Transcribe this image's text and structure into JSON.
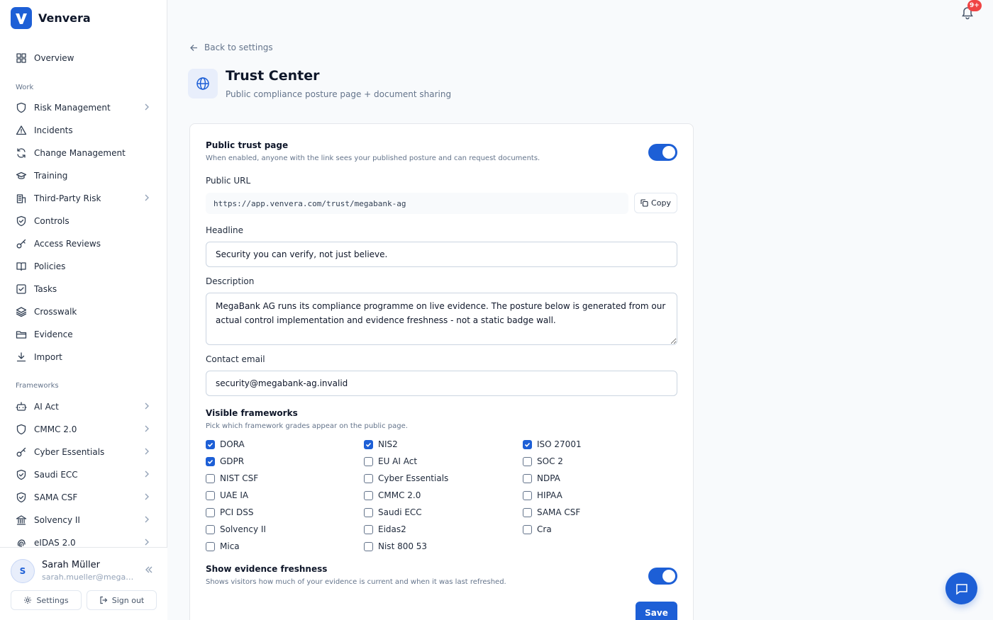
{
  "app": {
    "name": "Venvera"
  },
  "sidebar": {
    "overview": {
      "label": "Overview",
      "icon": "grid-icon"
    },
    "work_label": "Work",
    "work_items": [
      {
        "label": "Risk Management",
        "icon": "shield-icon",
        "has_chevron": true
      },
      {
        "label": "Incidents",
        "icon": "alert-triangle-icon",
        "has_chevron": false
      },
      {
        "label": "Change Management",
        "icon": "refresh-icon",
        "has_chevron": false
      },
      {
        "label": "Training",
        "icon": "graduation-cap-icon",
        "has_chevron": false
      },
      {
        "label": "Third-Party Risk",
        "icon": "building-icon",
        "has_chevron": true
      },
      {
        "label": "Controls",
        "icon": "shield-check-icon",
        "has_chevron": false
      },
      {
        "label": "Access Reviews",
        "icon": "key-icon",
        "has_chevron": false
      },
      {
        "label": "Policies",
        "icon": "book-icon",
        "has_chevron": false
      },
      {
        "label": "Tasks",
        "icon": "checkbox-icon",
        "has_chevron": false
      },
      {
        "label": "Crosswalk",
        "icon": "layers-icon",
        "has_chevron": false
      },
      {
        "label": "Evidence",
        "icon": "folder-icon",
        "has_chevron": false
      },
      {
        "label": "Import",
        "icon": "download-icon",
        "has_chevron": false
      }
    ],
    "frameworks_label": "Frameworks",
    "framework_items": [
      {
        "label": "AI Act",
        "icon": "bot-icon",
        "has_chevron": true
      },
      {
        "label": "CMMC 2.0",
        "icon": "shield-icon",
        "has_chevron": true
      },
      {
        "label": "Cyber Essentials",
        "icon": "key-icon",
        "has_chevron": true
      },
      {
        "label": "Saudi ECC",
        "icon": "shield-check-icon",
        "has_chevron": true
      },
      {
        "label": "SAMA CSF",
        "icon": "shield-check-icon",
        "has_chevron": true
      },
      {
        "label": "Solvency II",
        "icon": "landmark-icon",
        "has_chevron": true
      },
      {
        "label": "eIDAS 2.0",
        "icon": "fingerprint-icon",
        "has_chevron": true
      }
    ],
    "user": {
      "initial": "S",
      "name": "Sarah Müller",
      "email": "sarah.mueller@megaba..."
    },
    "settings_label": "Settings",
    "signout_label": "Sign out"
  },
  "header": {
    "notification_badge": "9+"
  },
  "page": {
    "back_label": "Back to settings",
    "title": "Trust Center",
    "subtitle": "Public compliance posture page + document sharing"
  },
  "form": {
    "public_page": {
      "title": "Public trust page",
      "hint": "When enabled, anyone with the link sees your published posture and can request documents.",
      "enabled": true
    },
    "public_url": {
      "label": "Public URL",
      "value": "https://app.venvera.com/trust/megabank-ag",
      "copy_label": "Copy"
    },
    "headline": {
      "label": "Headline",
      "value": "Security you can verify, not just believe."
    },
    "description": {
      "label": "Description",
      "value": "MegaBank AG runs its compliance programme on live evidence. The posture below is generated from our actual control implementation and evidence freshness - not a static badge wall."
    },
    "contact_email": {
      "label": "Contact email",
      "value": "security@megabank-ag.invalid"
    },
    "frameworks": {
      "title": "Visible frameworks",
      "hint": "Pick which framework grades appear on the public page.",
      "items": [
        {
          "label": "DORA",
          "checked": true
        },
        {
          "label": "NIS2",
          "checked": true
        },
        {
          "label": "ISO 27001",
          "checked": true
        },
        {
          "label": "GDPR",
          "checked": true
        },
        {
          "label": "EU AI Act",
          "checked": false
        },
        {
          "label": "SOC 2",
          "checked": false
        },
        {
          "label": "NIST CSF",
          "checked": false
        },
        {
          "label": "Cyber Essentials",
          "checked": false
        },
        {
          "label": "NDPA",
          "checked": false
        },
        {
          "label": "UAE IA",
          "checked": false
        },
        {
          "label": "CMMC 2.0",
          "checked": false
        },
        {
          "label": "HIPAA",
          "checked": false
        },
        {
          "label": "PCI DSS",
          "checked": false
        },
        {
          "label": "Saudi ECC",
          "checked": false
        },
        {
          "label": "SAMA CSF",
          "checked": false
        },
        {
          "label": "Solvency II",
          "checked": false
        },
        {
          "label": "Eidas2",
          "checked": false
        },
        {
          "label": "Cra",
          "checked": false
        },
        {
          "label": "Mica",
          "checked": false
        },
        {
          "label": "Nist 800 53",
          "checked": false
        }
      ]
    },
    "freshness": {
      "title": "Show evidence freshness",
      "hint": "Shows visitors how much of your evidence is current and when it was last refreshed.",
      "enabled": true
    },
    "save_label": "Save"
  },
  "colors": {
    "accent": "#1d5fd6",
    "badge": "#ef4444"
  }
}
